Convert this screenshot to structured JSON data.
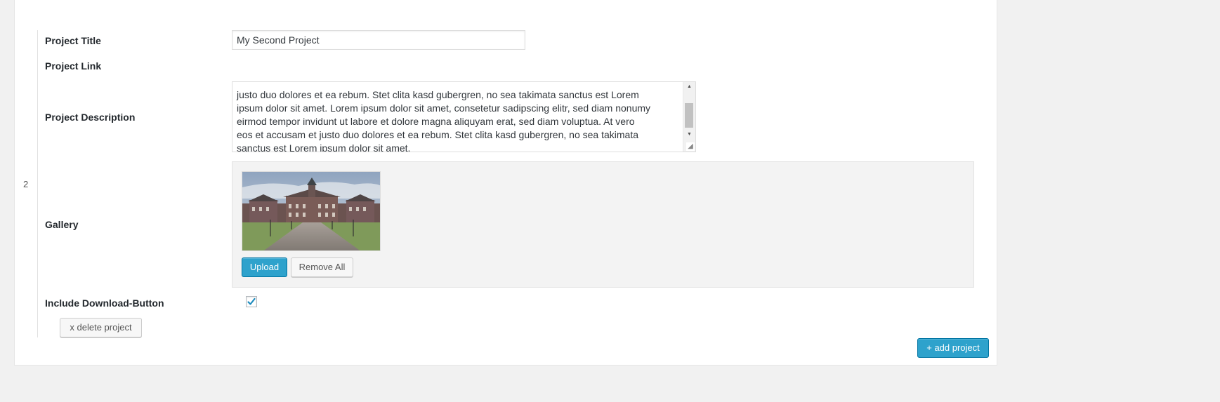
{
  "project": {
    "number": "2",
    "title_label": "Project Title",
    "title_value": "My Second Project",
    "link_label": "Project Link",
    "description_label": "Project Description",
    "description_lines": [
      "justo duo dolores et ea rebum. Stet clita kasd gubergren, no sea takimata sanctus est Lorem",
      "ipsum dolor sit amet. Lorem ipsum dolor sit amet, consetetur sadipscing elitr, sed diam nonumy",
      "eirmod tempor invidunt ut labore et dolore magna aliquyam erat, sed diam voluptua. At vero",
      "eos et accusam et justo duo dolores et ea rebum. Stet clita kasd gubergren, no sea takimata",
      "sanctus est Lorem ipsum dolor sit amet."
    ],
    "gallery_label": "Gallery",
    "upload_label": "Upload",
    "remove_all_label": "Remove All",
    "download_label": "Include Download-Button",
    "download_checked": true,
    "delete_label": "x delete project"
  },
  "add_project_label": "+ add project",
  "icons": {
    "scroll_up": "arrow-up-icon",
    "scroll_down": "arrow-down-icon",
    "resize": "resize-grip-icon",
    "check": "checkmark-icon"
  },
  "colors": {
    "primary_button": "#2ea2cc",
    "checkmark": "#1e8cbe",
    "page_background": "#f1f1f1"
  }
}
